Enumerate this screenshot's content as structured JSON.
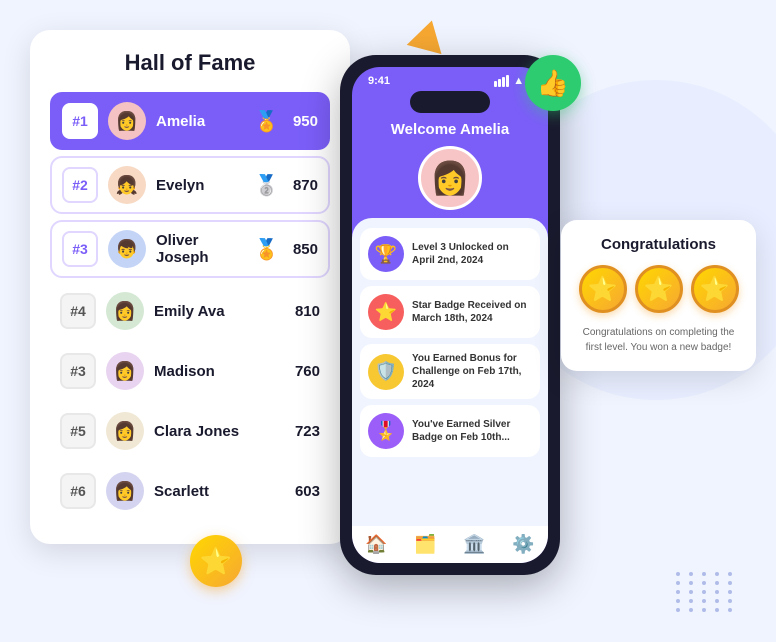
{
  "page": {
    "background_color": "#f0f4ff"
  },
  "hall_of_fame": {
    "title": "Hall of Fame",
    "rows": [
      {
        "rank": "#1",
        "name": "Amelia",
        "score": "950",
        "medal": "🏅",
        "style": "highlighted",
        "rank_style": "purple-fill",
        "avatar_class": "av1",
        "avatar_emoji": "👩"
      },
      {
        "rank": "#2",
        "name": "Evelyn",
        "score": "870",
        "medal": "🥈",
        "style": "bordered",
        "rank_style": "purple-outline",
        "avatar_class": "av2",
        "avatar_emoji": "👧"
      },
      {
        "rank": "#3",
        "name": "Oliver Joseph",
        "score": "850",
        "medal": "🏅",
        "style": "bordered",
        "rank_style": "purple-outline",
        "avatar_class": "av3",
        "avatar_emoji": "👦"
      },
      {
        "rank": "#4",
        "name": "Emily Ava",
        "score": "810",
        "medal": "",
        "style": "plain",
        "rank_style": "gray",
        "avatar_class": "av4",
        "avatar_emoji": "👩"
      },
      {
        "rank": "#3",
        "name": "Madison",
        "score": "760",
        "medal": "",
        "style": "plain",
        "rank_style": "gray",
        "avatar_class": "av5",
        "avatar_emoji": "👩"
      },
      {
        "rank": "#5",
        "name": "Clara Jones",
        "score": "723",
        "medal": "",
        "style": "plain",
        "rank_style": "gray",
        "avatar_class": "av6",
        "avatar_emoji": "👩"
      },
      {
        "rank": "#6",
        "name": "Scarlett",
        "score": "603",
        "medal": "",
        "style": "plain",
        "rank_style": "gray",
        "avatar_class": "av7",
        "avatar_emoji": "👩"
      }
    ]
  },
  "phone": {
    "time": "9:41",
    "welcome_text": "Welcome Amelia",
    "activities": [
      {
        "text": "Level 3 Unlocked on April 2nd, 2024",
        "icon_class": "blue",
        "icon": "🏆"
      },
      {
        "text": "Star Badge Received on March 18th, 2024",
        "icon_class": "red",
        "icon": "⭐"
      },
      {
        "text": "You Earned Bonus for Challenge on Feb 17th, 2024",
        "icon_class": "yellow",
        "icon": "🛡️"
      },
      {
        "text": "You've Earned Silver Badge on Feb 10th...",
        "icon_class": "purple",
        "icon": "🎖️"
      }
    ],
    "nav_items": [
      "🏠",
      "🗂️",
      "🏛️",
      "⚙️"
    ]
  },
  "congrats_card": {
    "title": "Congratulations",
    "stars_count": 3,
    "star_emoji": "⭐",
    "text": "Congratulations on completing the first level. You won a new badge!"
  },
  "thumbs_up": {
    "emoji": "👍"
  },
  "gold_star": {
    "emoji": "⭐"
  }
}
